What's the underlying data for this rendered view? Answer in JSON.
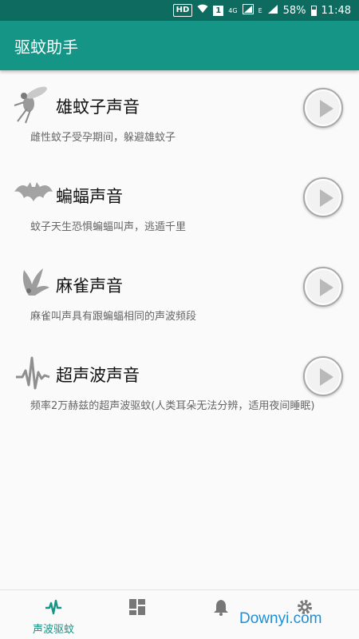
{
  "status_bar": {
    "hd": "HD",
    "sim": "1",
    "network": "4G",
    "edge": "E",
    "battery": "58%",
    "time": "11:48"
  },
  "app_bar": {
    "title": "驱蚊助手"
  },
  "items": [
    {
      "title": "雄蚊子声音",
      "desc": "雌性蚊子受孕期间，躲避雄蚊子",
      "icon": "mosquito-icon"
    },
    {
      "title": "蝙蝠声音",
      "desc": "蚊子天生恐惧蝙蝠叫声，逃遁千里",
      "icon": "bat-icon"
    },
    {
      "title": "麻雀声音",
      "desc": "麻雀叫声具有跟蝙蝠相同的声波频段",
      "icon": "sparrow-icon"
    },
    {
      "title": "超声波声音",
      "desc": "频率2万赫兹的超声波驱蚊(人类耳朵无法分辨，适用夜间睡眠)",
      "icon": "waveform-icon"
    }
  ],
  "bottom_nav": {
    "active_label": "声波驱蚊",
    "active_color": "#149585"
  },
  "watermark": "Downyi.com",
  "colors": {
    "status_bar": "#0d6b5f",
    "app_bar": "#149585"
  }
}
